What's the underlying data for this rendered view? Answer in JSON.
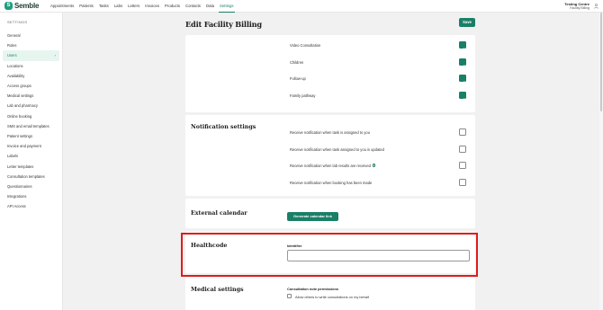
{
  "app": {
    "brand": "Semble",
    "brand_mark": "S"
  },
  "nav": {
    "items": [
      {
        "label": "Appointments"
      },
      {
        "label": "Patients"
      },
      {
        "label": "Tasks"
      },
      {
        "label": "Labs"
      },
      {
        "label": "Letters"
      },
      {
        "label": "Invoices"
      },
      {
        "label": "Products"
      },
      {
        "label": "Contacts"
      },
      {
        "label": "Data"
      },
      {
        "label": "Settings",
        "active": true
      }
    ]
  },
  "tenant": {
    "name": "Testing Centre",
    "subtitle": "Facility Billing"
  },
  "sidebar": {
    "title": "SETTINGS",
    "items": [
      {
        "label": "General"
      },
      {
        "label": "Roles"
      },
      {
        "label": "Users",
        "active": true
      },
      {
        "label": "Locations"
      },
      {
        "label": "Availability"
      },
      {
        "label": "Access groups"
      },
      {
        "label": "Medical settings"
      },
      {
        "label": "Lab and pharmacy"
      },
      {
        "label": "Online booking"
      },
      {
        "label": "SMS and email templates"
      },
      {
        "label": "Patient settings"
      },
      {
        "label": "Invoice and payment"
      },
      {
        "label": "Labels"
      },
      {
        "label": "Letter templates"
      },
      {
        "label": "Consultation templates"
      },
      {
        "label": "Questionnaires"
      },
      {
        "label": "Integrations"
      },
      {
        "label": "API Access"
      }
    ]
  },
  "page": {
    "title": "Edit Facility Billing",
    "save_label": "Save"
  },
  "consultation_types": {
    "rows": [
      {
        "label": "Video Consultation",
        "checked": true
      },
      {
        "label": "Children",
        "checked": true
      },
      {
        "label": "Follow-up",
        "checked": true
      },
      {
        "label": "Family pathway",
        "checked": true
      }
    ]
  },
  "notification_settings": {
    "title": "Notification settings",
    "rows": [
      {
        "label": "Receive notification when task is assigned to you",
        "checked": false
      },
      {
        "label": "Receive notification when task assigned to you is updated",
        "checked": false
      },
      {
        "label": "Receive notification when lab results are received",
        "checked": false,
        "info": true
      },
      {
        "label": "Receive notification when booking has been made",
        "checked": false
      }
    ]
  },
  "external_calendar": {
    "title": "External calendar",
    "button_label": "Generate calendar link"
  },
  "healthcode": {
    "title": "Healthcode",
    "field_label": "Identifier",
    "value": ""
  },
  "medical_settings": {
    "title": "Medical settings",
    "field_label": "Consultation note permissions",
    "checkbox_label": "Allow others to write consultations on my behalf",
    "checked": false
  },
  "colors": {
    "accent": "#1a7f67",
    "highlight": "#e01b1b",
    "background": "#f1f1f1"
  }
}
